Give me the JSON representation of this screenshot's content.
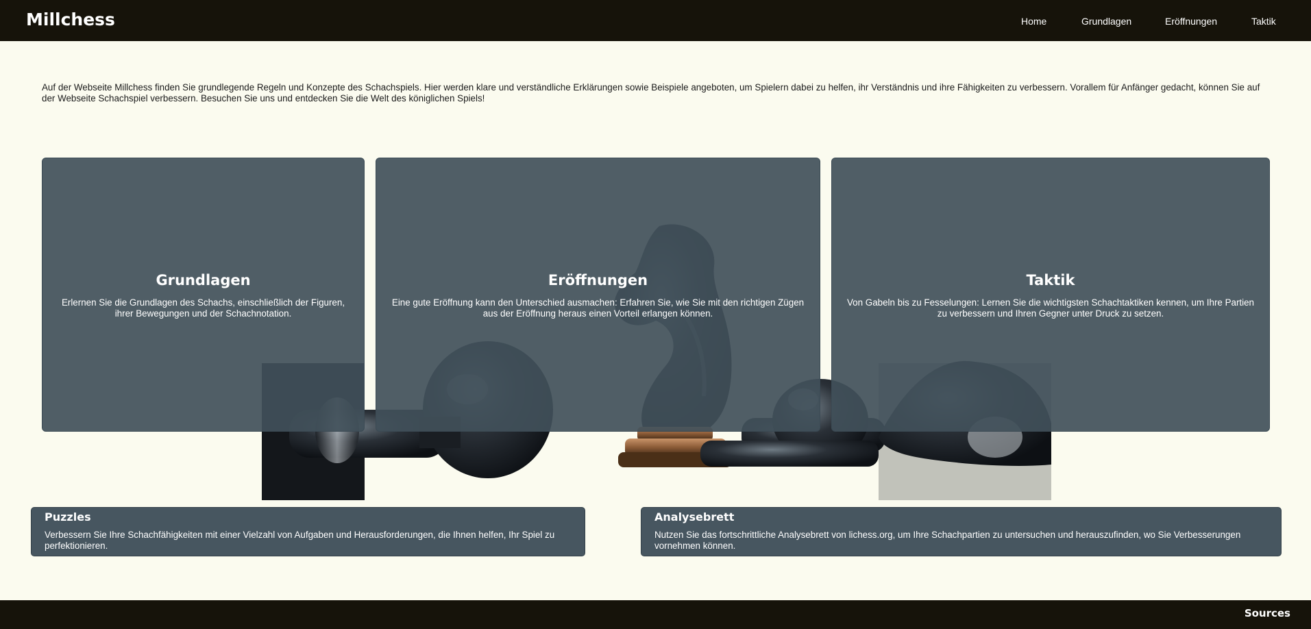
{
  "header": {
    "brand": "Millchess",
    "nav": [
      "Home",
      "Grundlagen",
      "Eröffnungen",
      "Taktik"
    ]
  },
  "intro": "Auf der Webseite Millchess finden Sie grundlegende Regeln und Konzepte des Schachspiels. Hier werden klare und verständliche Erklärungen sowie Beispiele angeboten, um Spielern dabei zu helfen, ihr Verständnis und ihre Fähigkeiten zu verbessern. Vorallem für Anfänger gedacht, können Sie auf der Webseite Schachspiel verbessern. Besuchen Sie uns und entdecken Sie die Welt des königlichen Spiels!",
  "cards": [
    {
      "title": "Grundlagen",
      "text": "Erlernen Sie die Grundlagen des Schachs, einschließlich der Figuren, ihrer Bewegungen und der Schachnotation."
    },
    {
      "title": "Eröffnungen",
      "text": "Eine gute Eröffnung kann den Unterschied ausmachen: Erfahren Sie, wie Sie mit den richtigen Zügen aus der Eröffnung heraus einen Vorteil erlangen können."
    },
    {
      "title": "Taktik",
      "text": "Von Gabeln bis zu Fesselungen: Lernen Sie die wichtigsten Schachtaktiken kennen, um Ihre Partien zu verbessern und Ihren Gegner unter Druck zu setzen."
    }
  ],
  "panels": [
    {
      "title": "Puzzles",
      "text": "Verbessern Sie Ihre Schachfähigkeiten mit einer Vielzahl von Aufgaben und Herausforderungen, die Ihnen helfen, Ihr Spiel zu perfektionieren."
    },
    {
      "title": "Analysebrett",
      "text": "Nutzen Sie das fortschrittliche Analysebrett von lichess.org, um Ihre Schachpartien zu untersuchen und herauszufinden, wo Sie Verbesserungen vornehmen können."
    }
  ],
  "footer": {
    "sources_label": "Sources"
  },
  "colors": {
    "bar": "#16130a",
    "background": "#fbfbef",
    "card": "#41505a"
  }
}
